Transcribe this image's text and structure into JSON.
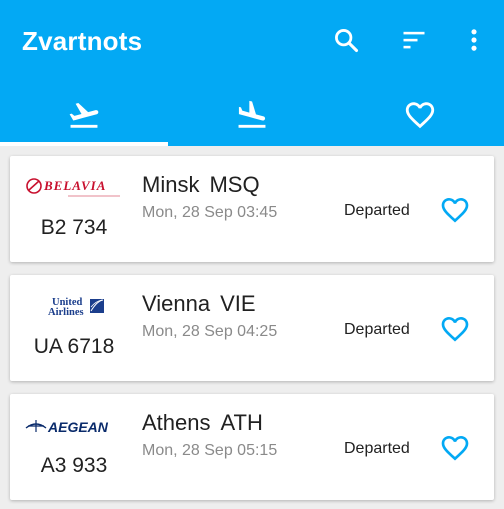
{
  "app": {
    "title": "Zvartnots",
    "accent": "#03a9f4"
  },
  "toolbar": {
    "actions": [
      "search-icon",
      "sort-icon",
      "more-vert-icon"
    ]
  },
  "tabs": [
    {
      "icon": "departures-icon",
      "selected": true
    },
    {
      "icon": "arrivals-icon",
      "selected": false
    },
    {
      "icon": "favorites-heart-icon",
      "selected": false
    }
  ],
  "flights": [
    {
      "airline_logo_text": "BELAVIA",
      "flight_no": "B2 734",
      "city": "Minsk",
      "code": "MSQ",
      "time": "Mon, 28 Sep 03:45",
      "status": "Departed"
    },
    {
      "airline_logo_text": "United Airlines",
      "flight_no": "UA 6718",
      "city": "Vienna",
      "code": "VIE",
      "time": "Mon, 28 Sep 04:25",
      "status": "Departed"
    },
    {
      "airline_logo_text": "AEGEAN",
      "flight_no": "A3 933",
      "city": "Athens",
      "code": "ATH",
      "time": "Mon, 28 Sep 05:15",
      "status": "Departed"
    }
  ]
}
